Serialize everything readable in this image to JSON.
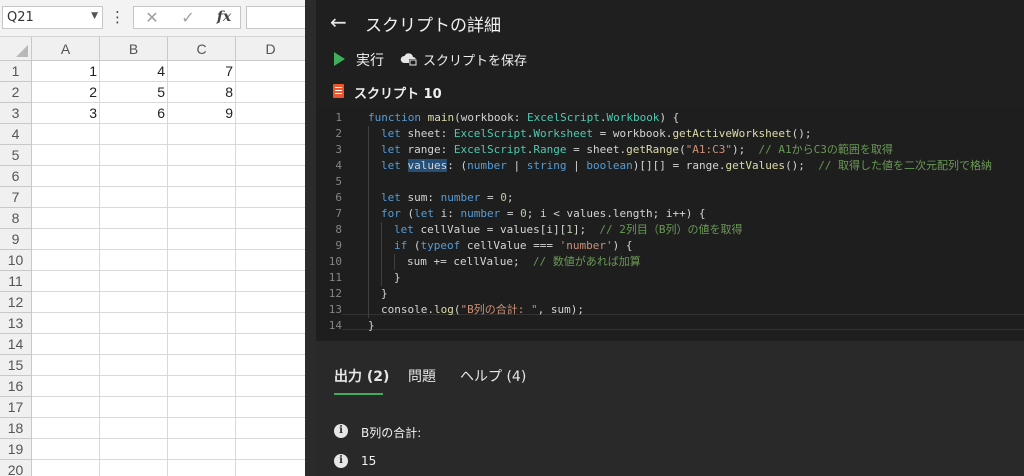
{
  "formula_bar": {
    "name_box": "Q21",
    "fx_label": "fx"
  },
  "sheet": {
    "columns": [
      "A",
      "B",
      "C",
      "D"
    ],
    "rows": [
      "1",
      "2",
      "3",
      "4",
      "5",
      "6",
      "7",
      "8",
      "9",
      "10",
      "11",
      "12",
      "13",
      "14",
      "15",
      "16",
      "17",
      "18",
      "19",
      "20"
    ],
    "cells": [
      [
        "1",
        "4",
        "7"
      ],
      [
        "2",
        "5",
        "8"
      ],
      [
        "3",
        "6",
        "9"
      ]
    ]
  },
  "pane": {
    "title": "スクリプトの詳細",
    "run_label": "実行",
    "save_label": "スクリプトを保存",
    "script_name": "スクリプト 10"
  },
  "code": {
    "line_numbers": [
      "1",
      "2",
      "3",
      "4",
      "5",
      "6",
      "7",
      "8",
      "9",
      "10",
      "11",
      "12",
      "13",
      "14"
    ],
    "highlight_word": "values",
    "current_line": "7"
  },
  "bottom": {
    "tabs": [
      "出力 (2)",
      "問題",
      "ヘルプ (4)"
    ],
    "outputs": [
      "B列の合計:",
      "15"
    ]
  },
  "colors": {
    "pane_bg": "#1f1f1f",
    "accent_green": "#3fae5a",
    "keyword": "#569cd6",
    "type": "#4ec9b0",
    "string": "#ce9178",
    "comment": "#6a9955"
  },
  "icons": [
    "back-arrow-icon",
    "play-icon",
    "save-cloud-icon",
    "script-file-icon",
    "info-icon",
    "cancel-icon",
    "check-icon",
    "chevron-down-icon",
    "more-icon"
  ]
}
